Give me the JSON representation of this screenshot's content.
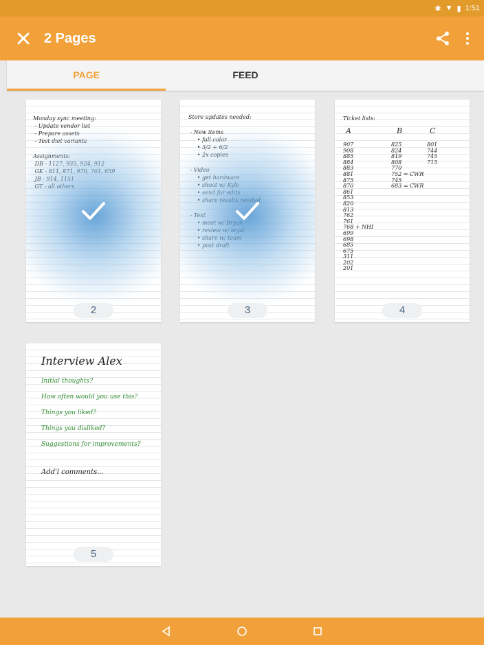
{
  "status_bar": {
    "time": "1:51",
    "icons": [
      "bluetooth-icon",
      "wifi-icon",
      "battery-icon"
    ]
  },
  "app_bar": {
    "title": "2 Pages",
    "close_icon": "close-icon",
    "share_icon": "share-icon",
    "more_icon": "more-vert-icon"
  },
  "tabs": [
    {
      "label": "PAGE",
      "active": true
    },
    {
      "label": "FEED",
      "active": false
    }
  ],
  "colors": {
    "accent": "#f2a13a",
    "status_bar": "#e29a2a",
    "selection_glow": "#5096d2",
    "page_number": "#4a6a86"
  },
  "pages": [
    {
      "number": "2",
      "selected": true,
      "content": "Monday sync meeting:\n - Update vendor list\n - Prepare assets\n - Test diet variants\n\nAssignments:\n DB - 1127, 935, 924, 912\n GK - 811, 871, 970, 701, 659\n JB - 914, 1151\n GT - all others"
    },
    {
      "number": "3",
      "selected": true,
      "content": "Store updates needed:\n\n - New items\n     • fall color\n     • 3/2 + 6/2\n     • 2x copies\n\n - Video\n     • get hardware\n     • shoot w/ Kyle\n     • send for edits\n     • share results needed\n\n - Text\n     • meet w/ Bryan\n     • review w/ legal\n     • share w/ team\n     • post draft"
    },
    {
      "number": "4",
      "selected": false,
      "title": "Ticket lists:",
      "columns": [
        {
          "header": "A",
          "values": [
            "907",
            "908",
            "885",
            "884",
            "883",
            "881",
            "875",
            "870",
            "861",
            "853",
            "820",
            "813",
            "762",
            "761",
            "768 + NHI",
            "699",
            "698",
            "685",
            "675",
            "311",
            "202",
            "201"
          ]
        },
        {
          "header": "B",
          "values": [
            "825",
            "824",
            "819",
            "808",
            "770",
            "752 = CWR",
            "745",
            "683 = CWR"
          ]
        },
        {
          "header": "C",
          "values": [
            "801",
            "744",
            "745",
            "715"
          ]
        }
      ]
    },
    {
      "number": "5",
      "selected": false,
      "title": "Interview Alex",
      "lines": [
        "Initial thoughts?",
        "How often would you use this?",
        "Things you liked?",
        "Things you disliked?",
        "Suggestions for improvements?",
        "Add'l comments..."
      ]
    }
  ],
  "nav_bar": {
    "back_icon": "back-icon",
    "home_icon": "home-icon",
    "recents_icon": "recents-icon"
  }
}
